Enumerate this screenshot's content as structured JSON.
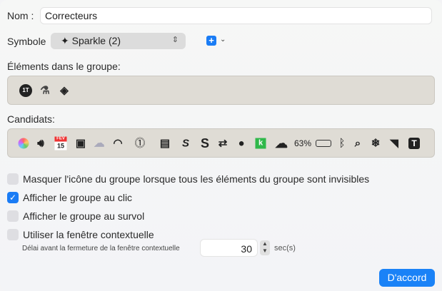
{
  "name": {
    "label": "Nom :",
    "value": "Correcteurs"
  },
  "symbol": {
    "label": "Symbole",
    "icon": "sparkle-icon",
    "value": "Sparkle (2)",
    "add_icon": "plus-square-icon"
  },
  "group": {
    "label": "Éléments dans le groupe:",
    "items": [
      "1t-circle-icon",
      "flask-icon",
      "diamond-icon"
    ]
  },
  "candidates": {
    "label": "Candidats:",
    "battery_percent": "63%",
    "items": [
      "colorsync-icon",
      "volume-icon",
      "calendar-icon",
      "contact-card-icon",
      "rain-cloud-icon",
      "wifi-icon",
      "info-pill-icon",
      "menu-icon",
      "s-slanted-icon",
      "s-bold-icon",
      "toggle-icon",
      "leaf-icon",
      "k-icon",
      "cloud-check-icon",
      "battery-icon",
      "bluetooth-icon",
      "search-icon",
      "snowflake-icon",
      "tag-icon",
      "t-square-icon"
    ],
    "calendar": {
      "month": "FÉV",
      "day": "15"
    },
    "k_color": "#2fb84a"
  },
  "options": [
    {
      "label": "Masquer l'icône du groupe lorsque tous les éléments du groupe sont invisibles",
      "checked": false
    },
    {
      "label": "Afficher le groupe au clic",
      "checked": true
    },
    {
      "label": "Afficher le groupe au survol",
      "checked": false
    },
    {
      "label": "Utiliser la fenêtre contextuelle",
      "checked": false
    }
  ],
  "delay": {
    "label": "Délai avant la fermeture de la fenêtre contextuelle",
    "value": "30",
    "unit": "sec(s)"
  },
  "ok_button": "D'accord",
  "accent": "#1a82f7"
}
